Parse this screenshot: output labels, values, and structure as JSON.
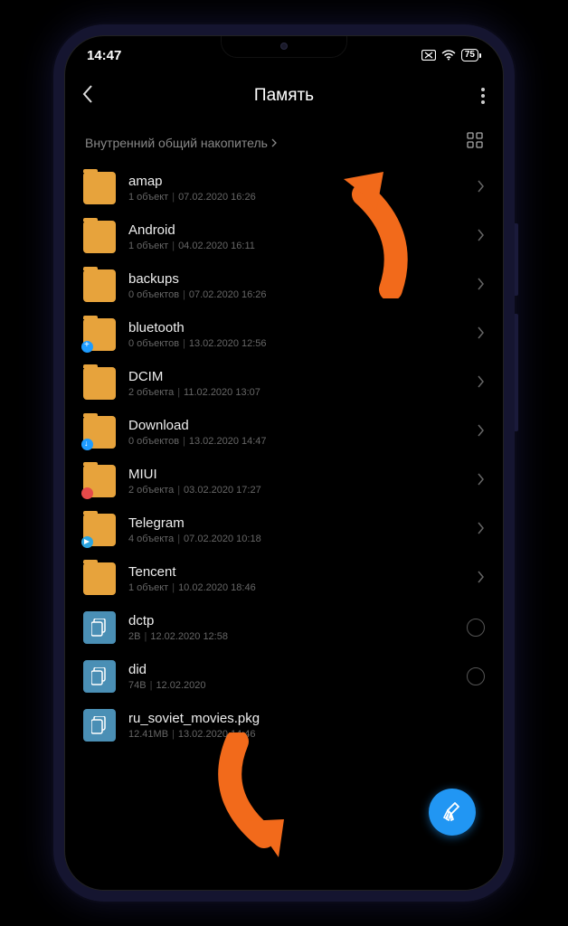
{
  "status": {
    "time": "14:47",
    "battery": "75"
  },
  "header": {
    "title": "Память"
  },
  "breadcrumb": {
    "path": "Внутренний общий накопитель"
  },
  "items": [
    {
      "name": "amap",
      "type": "folder",
      "count": "1 объект",
      "date": "07.02.2020 16:26",
      "badge": null,
      "action": "chevron"
    },
    {
      "name": "Android",
      "type": "folder",
      "count": "1 объект",
      "date": "04.02.2020 16:11",
      "badge": null,
      "action": "chevron"
    },
    {
      "name": "backups",
      "type": "folder",
      "count": "0 объектов",
      "date": "07.02.2020 16:26",
      "badge": null,
      "action": "chevron"
    },
    {
      "name": "bluetooth",
      "type": "folder",
      "count": "0 объектов",
      "date": "13.02.2020 12:56",
      "badge": "blue",
      "action": "chevron"
    },
    {
      "name": "DCIM",
      "type": "folder",
      "count": "2 объекта",
      "date": "11.02.2020 13:07",
      "badge": null,
      "action": "chevron"
    },
    {
      "name": "Download",
      "type": "folder",
      "count": "0 объектов",
      "date": "13.02.2020 14:47",
      "badge": "dl",
      "action": "chevron"
    },
    {
      "name": "MIUI",
      "type": "folder",
      "count": "2 объекта",
      "date": "03.02.2020 17:27",
      "badge": "red",
      "action": "chevron"
    },
    {
      "name": "Telegram",
      "type": "folder",
      "count": "4 объекта",
      "date": "07.02.2020 10:18",
      "badge": "tg",
      "action": "chevron"
    },
    {
      "name": "Tencent",
      "type": "folder",
      "count": "1 объект",
      "date": "10.02.2020 18:46",
      "badge": null,
      "action": "chevron"
    },
    {
      "name": "dctp",
      "type": "file",
      "count": "2B",
      "date": "12.02.2020 12:58",
      "badge": null,
      "action": "radio"
    },
    {
      "name": "did",
      "type": "file",
      "count": "74B",
      "date": "12.02.2020",
      "badge": null,
      "action": "radio"
    },
    {
      "name": "ru_soviet_movies.pkg",
      "type": "file",
      "count": "12.41MB",
      "date": "13.02.2020 14:46",
      "badge": null,
      "action": "none"
    }
  ],
  "colors": {
    "folder": "#e7a33c",
    "file": "#4a8fb5",
    "accent": "#2196f3",
    "arrow": "#f26a1b"
  }
}
